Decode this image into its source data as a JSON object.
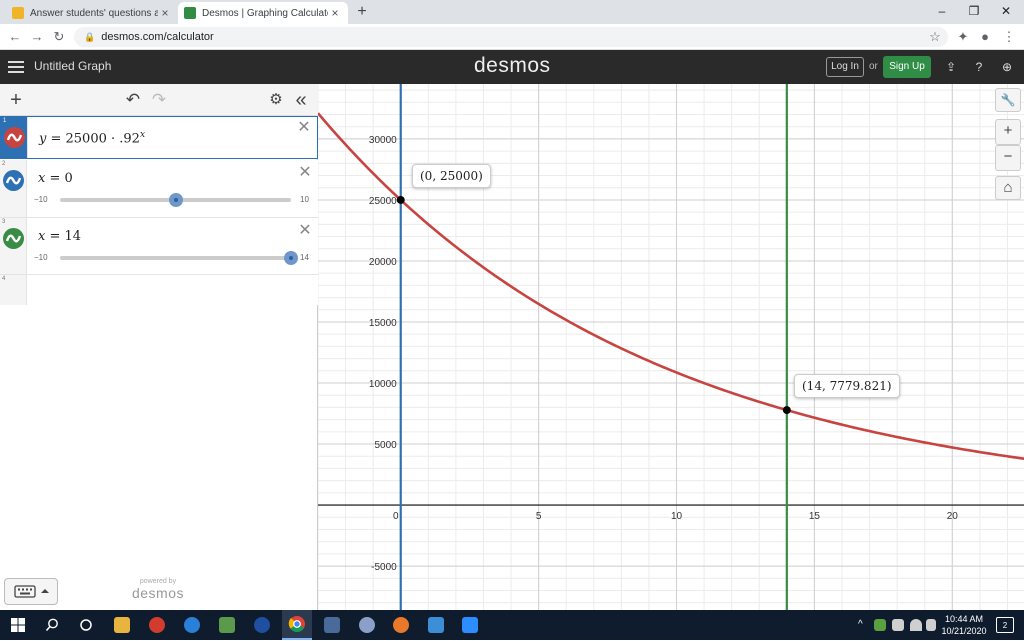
{
  "browser": {
    "tabs": [
      {
        "title": "Answer students' questions and e",
        "active": false,
        "close": "×"
      },
      {
        "title": "Desmos | Graphing Calculator",
        "active": true,
        "close": "×"
      }
    ],
    "new_tab": "+",
    "window_controls": {
      "minimize": "–",
      "restore": "❐",
      "close": "✕"
    },
    "url": "desmos.com/calculator",
    "nav": {
      "back": "←",
      "forward": "→",
      "reload": "↻"
    },
    "bookmark_icon": "☆",
    "extensions_icon": "✦",
    "profile_icon": "●",
    "menu_icon": "⋮"
  },
  "header": {
    "graph_title": "Untitled Graph",
    "logo": "desmos",
    "login_label": "Log In",
    "or_label": "or",
    "signup_label": "Sign Up",
    "signup_color": "#2f8d46",
    "icons": {
      "share": "⇪",
      "help": "?",
      "language": "⊕"
    }
  },
  "panel": {
    "add_icon": "+",
    "undo_icon": "↶",
    "redo_icon": "↷",
    "settings_icon": "⚙",
    "collapse_icon": "«",
    "delete_icon": "✕",
    "expressions": [
      {
        "num": "1",
        "latex_parts": [
          "y",
          " = 25000 · .92",
          "x"
        ],
        "color": "#c74440"
      },
      {
        "num": "2",
        "lhs": "x",
        "rhs": " = 0",
        "color": "#2d70b3",
        "slider": {
          "min": "−10",
          "max": "10",
          "value": 0
        }
      },
      {
        "num": "3",
        "lhs": "x",
        "rhs": " = 14",
        "color": "#388c46",
        "slider": {
          "min": "−10",
          "max": "14",
          "value": 14
        }
      },
      {
        "num": "4"
      }
    ],
    "powered_by": "powered by",
    "powered_logo": "desmos"
  },
  "graph": {
    "tools": {
      "wrench": "🔧",
      "zoom_in": "+",
      "zoom_out": "−",
      "home": "⌂"
    },
    "point_labels": [
      {
        "text": "(0, 25000)",
        "x": 0,
        "y": 25000
      },
      {
        "text": "(14, 7779.821)",
        "x": 14,
        "y": 7779.821
      }
    ]
  },
  "chart_data": {
    "type": "line",
    "title": "",
    "xlabel": "",
    "ylabel": "",
    "xlim": [
      -3,
      22.6
    ],
    "ylim": [
      -8600,
      34500
    ],
    "x_ticks": [
      "0",
      "5",
      "10",
      "15",
      "20"
    ],
    "y_ticks": [
      "-5000",
      "5000",
      "10000",
      "15000",
      "20000",
      "25000",
      "30000"
    ],
    "grid": true,
    "series": [
      {
        "expression": "y = 25000 · .92^x",
        "color": "#c74440"
      },
      {
        "expression": "x = 0",
        "color": "#2d70b3"
      },
      {
        "expression": "x = 14",
        "color": "#388c46"
      }
    ],
    "points": [
      {
        "x": 0,
        "y": 25000
      },
      {
        "x": 14,
        "y": 7779.821
      }
    ]
  },
  "taskbar": {
    "clock_time": "10:44 AM",
    "clock_date": "10/21/2020",
    "notification_count": "2"
  }
}
